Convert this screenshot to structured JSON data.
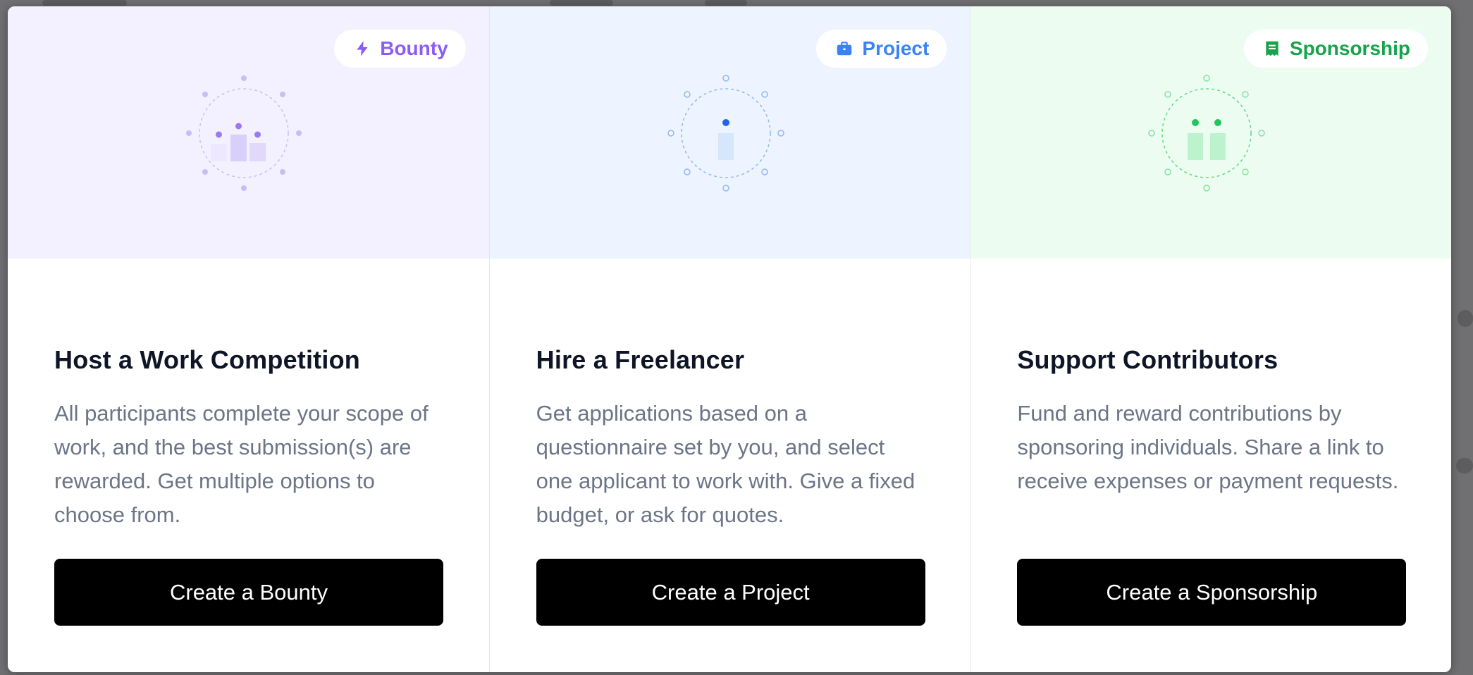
{
  "colors": {
    "bounty_bg": "#f3f0ff",
    "project_bg": "#edf4ff",
    "sponsorship_bg": "#edfcf1",
    "bounty_accent": "#8b5cf6",
    "project_accent": "#3b82f6",
    "sponsorship_accent": "#16a34a"
  },
  "cards": [
    {
      "badge": {
        "label": "Bounty",
        "icon": "lightning-icon"
      },
      "title": "Host a Work Competition",
      "description": "All participants complete your scope of work, and the best submission(s) are rewarded. Get multiple options to choose from.",
      "button_label": "Create a Bounty"
    },
    {
      "badge": {
        "label": "Project",
        "icon": "briefcase-icon"
      },
      "title": "Hire a Freelancer",
      "description": "Get applications based on a questionnaire set by you, and select one applicant to work with. Give a fixed budget, or ask for quotes.",
      "button_label": "Create a Project"
    },
    {
      "badge": {
        "label": "Sponsorship",
        "icon": "receipt-icon"
      },
      "title": "Support Contributors",
      "description": "Fund and reward contributions by sponsoring individuals. Share a link to receive expenses or payment requests.",
      "button_label": "Create a Sponsorship"
    }
  ]
}
